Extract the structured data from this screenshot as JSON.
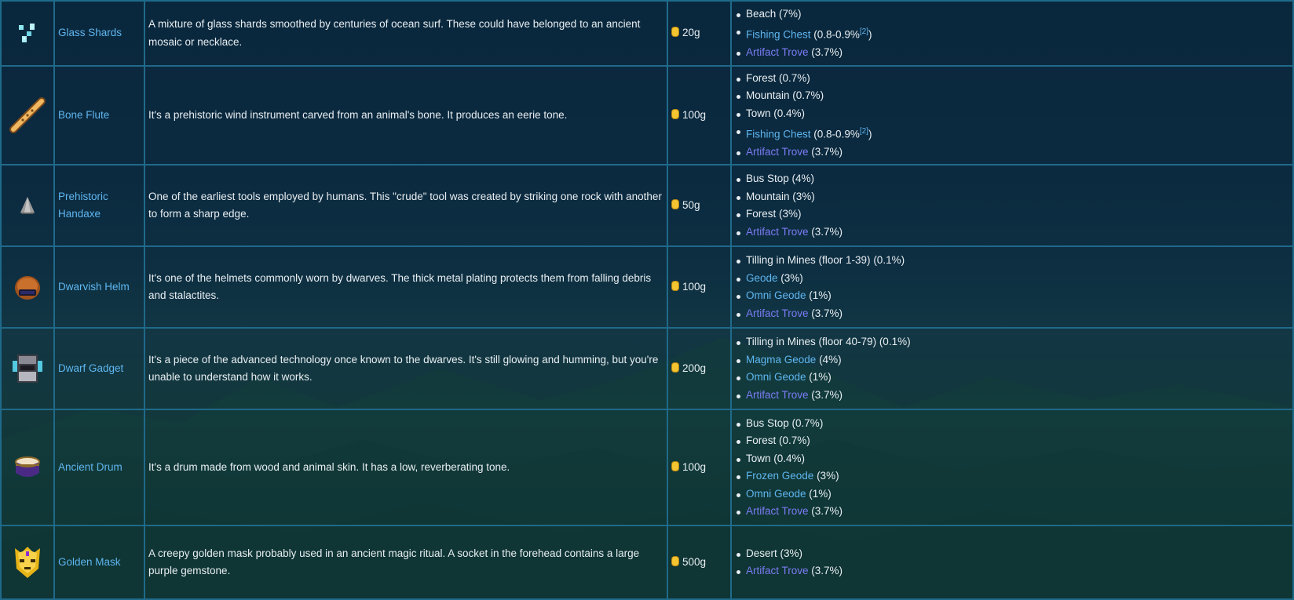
{
  "accent_link": "#5fb6f0",
  "accent_trove": "#7c7cf5",
  "rows": [
    {
      "icon": "glass-shards-icon",
      "name": "Glass Shards",
      "desc": "A mixture of glass shards smoothed by centuries of ocean surf. These could have belonged to an ancient mosaic or necklace.",
      "price": "20g",
      "locations": [
        {
          "text": "Beach",
          "pct": " (7%)"
        },
        {
          "link": "Fishing Chest",
          "pct": " (0.8-0.9%",
          "sup": "[2]",
          "tail": ")"
        },
        {
          "trove": "Artifact Trove",
          "pct": " (3.7%)"
        }
      ]
    },
    {
      "icon": "bone-flute-icon",
      "name": "Bone Flute",
      "desc": "It's a prehistoric wind instrument carved from an animal's bone. It produces an eerie tone.",
      "price": "100g",
      "locations": [
        {
          "text": "Forest",
          "pct": " (0.7%)"
        },
        {
          "text": "Mountain",
          "pct": " (0.7%)"
        },
        {
          "text": "Town",
          "pct": " (0.4%)"
        },
        {
          "link": "Fishing Chest",
          "pct": " (0.8-0.9%",
          "sup": "[2]",
          "tail": ")"
        },
        {
          "trove": "Artifact Trove",
          "pct": " (3.7%)"
        }
      ]
    },
    {
      "icon": "prehistoric-handaxe-icon",
      "name": "Prehistoric Handaxe",
      "desc": "One of the earliest tools employed by humans. This \"crude\" tool was created by striking one rock with another to form a sharp edge.",
      "price": "50g",
      "locations": [
        {
          "text": "Bus Stop",
          "pct": " (4%)"
        },
        {
          "text": "Mountain",
          "pct": " (3%)"
        },
        {
          "text": "Forest",
          "pct": " (3%)"
        },
        {
          "trove": "Artifact Trove",
          "pct": " (3.7%)"
        }
      ]
    },
    {
      "icon": "dwarvish-helm-icon",
      "name": "Dwarvish Helm",
      "desc": "It's one of the helmets commonly worn by dwarves. The thick metal plating protects them from falling debris and stalactites.",
      "price": "100g",
      "locations": [
        {
          "text": "Tilling in Mines (floor 1-39)",
          "pct": " (0.1%)"
        },
        {
          "link": "Geode",
          "pct": " (3%)"
        },
        {
          "link": "Omni Geode",
          "pct": " (1%)"
        },
        {
          "trove": "Artifact Trove",
          "pct": " (3.7%)"
        }
      ]
    },
    {
      "icon": "dwarf-gadget-icon",
      "name": "Dwarf Gadget",
      "desc": "It's a piece of the advanced technology once known to the dwarves. It's still glowing and humming, but you're unable to understand how it works.",
      "price": "200g",
      "locations": [
        {
          "text": "Tilling in Mines (floor 40-79)",
          "pct": " (0.1%)"
        },
        {
          "link": "Magma Geode",
          "pct": " (4%)"
        },
        {
          "link": "Omni Geode",
          "pct": " (1%)"
        },
        {
          "trove": "Artifact Trove",
          "pct": " (3.7%)"
        }
      ]
    },
    {
      "icon": "ancient-drum-icon",
      "name": "Ancient Drum",
      "desc": "It's a drum made from wood and animal skin. It has a low, reverberating tone.",
      "price": "100g",
      "locations": [
        {
          "text": "Bus Stop",
          "pct": " (0.7%)"
        },
        {
          "text": "Forest",
          "pct": " (0.7%)"
        },
        {
          "text": "Town",
          "pct": " (0.4%)"
        },
        {
          "link": "Frozen Geode",
          "pct": " (3%)"
        },
        {
          "link": "Omni Geode",
          "pct": " (1%)"
        },
        {
          "trove": "Artifact Trove",
          "pct": " (3.7%)"
        }
      ]
    },
    {
      "icon": "golden-mask-icon",
      "name": "Golden Mask",
      "desc": "A creepy golden mask probably used in an ancient magic ritual. A socket in the forehead contains a large purple gemstone.",
      "price": "500g",
      "locations": [
        {
          "text": "Desert",
          "pct": " (3%)"
        },
        {
          "trove": "Artifact Trove",
          "pct": " (3.7%)"
        }
      ]
    }
  ]
}
